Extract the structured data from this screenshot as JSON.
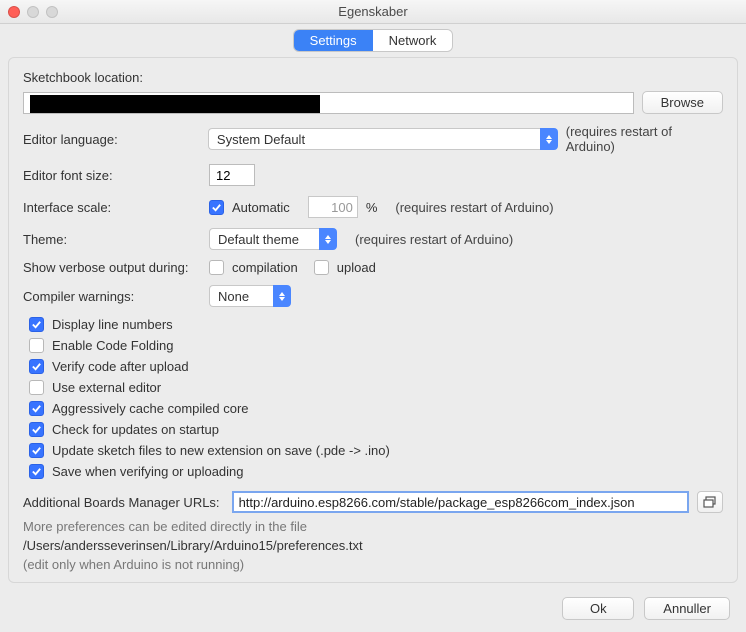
{
  "window": {
    "title": "Egenskaber"
  },
  "tabs": {
    "settings": "Settings",
    "network": "Network"
  },
  "labels": {
    "sketchbook": "Sketchbook location:",
    "browse": "Browse",
    "editor_language": "Editor language:",
    "requires_restart": "(requires restart of Arduino)",
    "editor_font_size": "Editor font size:",
    "interface_scale": "Interface scale:",
    "automatic": "Automatic",
    "percent": "%",
    "theme": "Theme:",
    "show_verbose": "Show verbose output during:",
    "compilation": "compilation",
    "upload": "upload",
    "compiler_warnings": "Compiler warnings:",
    "additional_urls": "Additional Boards Manager URLs:",
    "more_prefs": "More preferences can be edited directly in the file",
    "edit_only": "(edit only when Arduino is not running)"
  },
  "values": {
    "language_select": "System Default",
    "font_size": "12",
    "scale_value": "100",
    "theme_select": "Default theme",
    "warnings_select": "None",
    "urls": "http://arduino.esp8266.com/stable/package_esp8266com_index.json",
    "prefs_path": "/Users/andersseverinsen/Library/Arduino15/preferences.txt"
  },
  "checkboxes": {
    "automatic": true,
    "compilation": false,
    "upload": false,
    "items": [
      {
        "label": "Display line numbers",
        "checked": true
      },
      {
        "label": "Enable Code Folding",
        "checked": false
      },
      {
        "label": "Verify code after upload",
        "checked": true
      },
      {
        "label": "Use external editor",
        "checked": false
      },
      {
        "label": "Aggressively cache compiled core",
        "checked": true
      },
      {
        "label": "Check for updates on startup",
        "checked": true
      },
      {
        "label": "Update sketch files to new extension on save (.pde -> .ino)",
        "checked": true
      },
      {
        "label": "Save when verifying or uploading",
        "checked": true
      }
    ]
  },
  "buttons": {
    "ok": "Ok",
    "cancel": "Annuller"
  }
}
